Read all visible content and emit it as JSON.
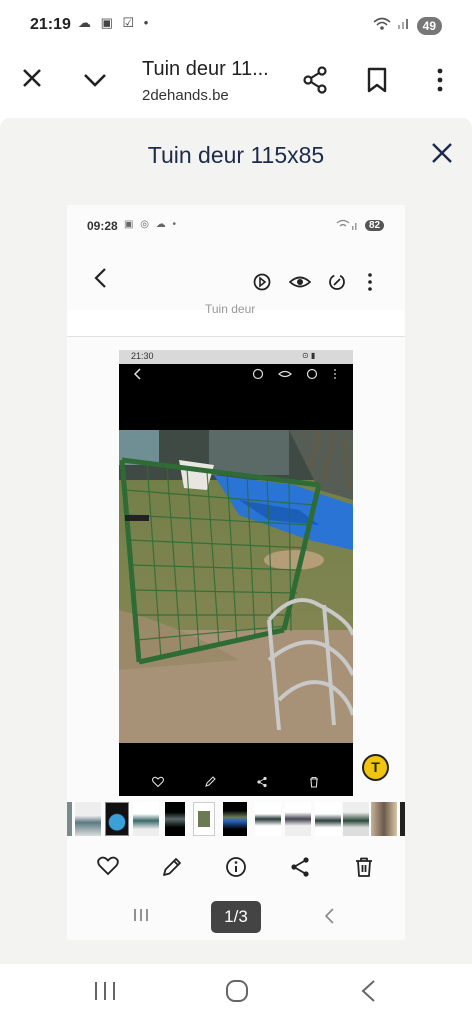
{
  "status_bar": {
    "time": "21:19",
    "icons": "☁ ▣ ☑ •",
    "battery": "49"
  },
  "browser": {
    "close_icon": "close-icon",
    "title": "Tuin deur 11...",
    "subtitle": "2dehands.be"
  },
  "sheet": {
    "title": "Tuin deur 115x85"
  },
  "inner_screenshot": {
    "time": "09:28",
    "icons": "▣ ◎ ☁ •",
    "battery": "82",
    "hidden_title": "Tuin deur"
  },
  "inner_photo": {
    "time": "21:30",
    "status_icons": "⊙ ▮"
  },
  "ocr_button": "T",
  "pager": {
    "label": "1/3"
  },
  "colors": {
    "sheet_bg": "#f3f3f1",
    "title_color": "#1e2a4a",
    "grass": "#7c8b4a",
    "gate": "#2e6b35",
    "tarp": "#1f6fd0"
  }
}
